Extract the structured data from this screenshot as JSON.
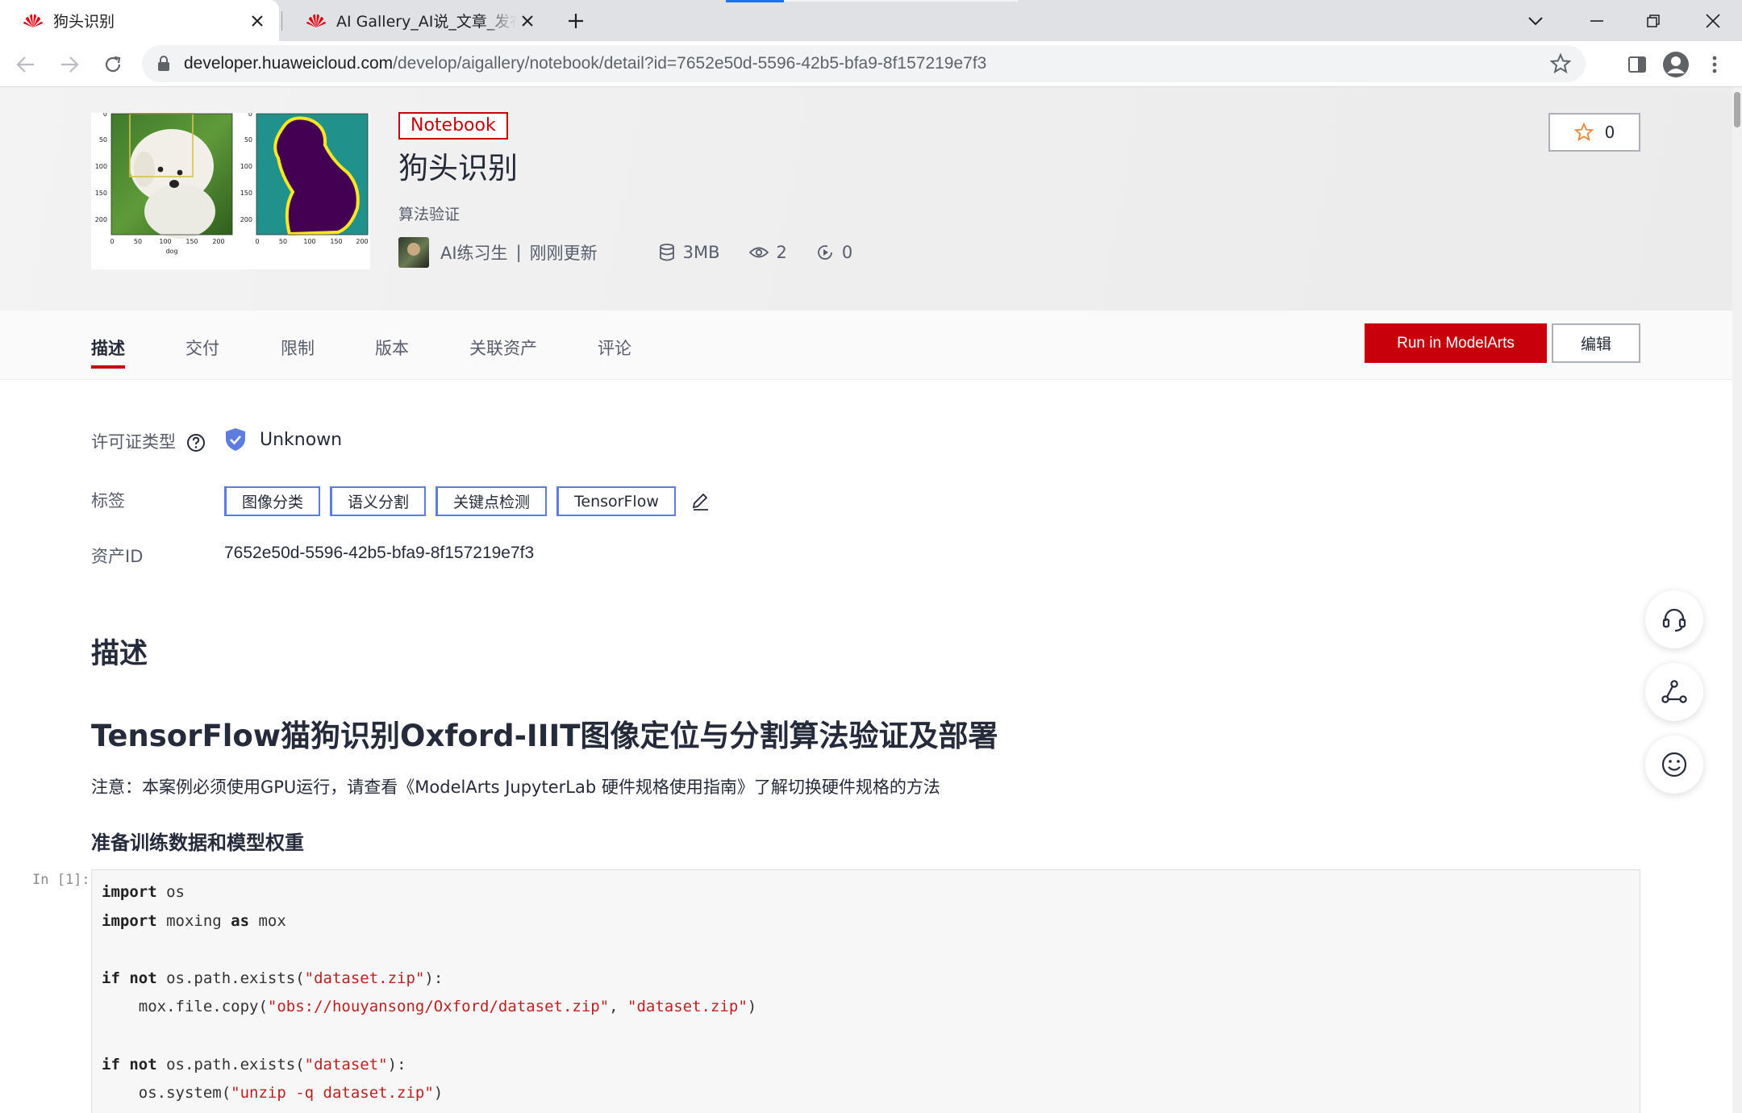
{
  "browser": {
    "tabs": [
      {
        "title": "狗头识别",
        "active": true
      },
      {
        "title": "AI Gallery_AI说_文章_发布_华为云",
        "active": false
      }
    ],
    "url_host": "developer.huaweicloud.com",
    "url_path": "/develop/aigallery/notebook/detail?id=7652e50d-5596-42b5-bfa9-8f157219e7f3"
  },
  "asset": {
    "badge": "Notebook",
    "title": "狗头识别",
    "subtitle": "算法验证",
    "author": "AI练习生",
    "separator": "|",
    "updated": "刚刚更新",
    "size": "3MB",
    "views": "2",
    "runs": "0",
    "favorites": "0"
  },
  "thumbnail": {
    "left_ticks_y": [
      "0",
      "50",
      "100",
      "150",
      "200"
    ],
    "left_ticks_x": [
      "0",
      "50",
      "100",
      "150",
      "200"
    ],
    "left_xlabel": "dog",
    "right_ticks_y": [
      "0",
      "50",
      "100",
      "150",
      "200"
    ],
    "right_ticks_x": [
      "0",
      "50",
      "100",
      "150",
      "200"
    ]
  },
  "tabs": [
    "描述",
    "交付",
    "限制",
    "版本",
    "关联资产",
    "评论"
  ],
  "actions": {
    "run": "Run in ModelArts",
    "edit": "编辑"
  },
  "details": {
    "license_label": "许可证类型",
    "license_value": "Unknown",
    "tags_label": "标签",
    "tags": [
      "图像分类",
      "语义分割",
      "关键点检测",
      "TensorFlow"
    ],
    "id_label": "资产ID",
    "id_value": "7652e50d-5596-42b5-bfa9-8f157219e7f3"
  },
  "content": {
    "section_title": "描述",
    "heading": "TensorFlow猫狗识别Oxford-IIIT图像定位与分割算法验证及部署",
    "note": "注意：本案例必须使用GPU运行，请查看《ModelArts JupyterLab 硬件规格使用指南》了解切换硬件规格的方法",
    "subheading": "准备训练数据和模型权重",
    "cell_prompt": "In [1]:",
    "code": {
      "l1_kw": "import",
      "l1_rest": " os",
      "l2_kw": "import",
      "l2_a": " moxing ",
      "l2_kw2": "as",
      "l2_b": " mox",
      "l4_kw": "if not",
      "l4_a": " os.path.exists(",
      "l4_s": "\"dataset.zip\"",
      "l4_b": "):",
      "l5_a": "    mox.file.copy(",
      "l5_s1": "\"obs://houyansong/Oxford/dataset.zip\"",
      "l5_b": ", ",
      "l5_s2": "\"dataset.zip\"",
      "l5_c": ")",
      "l7_kw": "if not",
      "l7_a": " os.path.exists(",
      "l7_s": "\"dataset\"",
      "l7_b": "):",
      "l8_a": "    os.system(",
      "l8_s": "\"unzip -q dataset.zip\"",
      "l8_b": ")"
    }
  }
}
